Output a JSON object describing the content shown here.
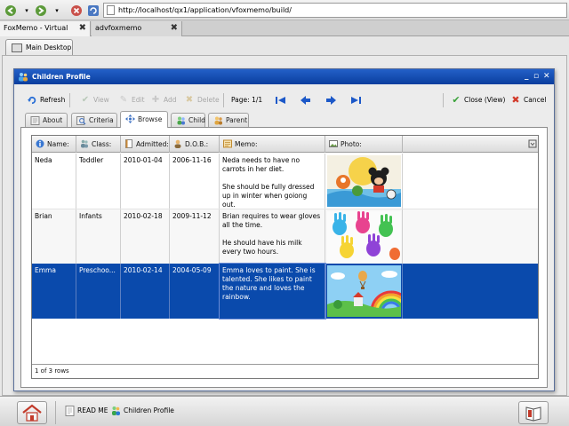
{
  "browser": {
    "url": "http://localhost/qx1/application/vfoxmemo/build/",
    "tabs": [
      {
        "label": "FoxMemo - Virtual"
      },
      {
        "label": "advfoxmemo"
      }
    ]
  },
  "desktop": {
    "tab_label": "Main Desktop"
  },
  "window": {
    "title": "Children Profile",
    "controls": {
      "minimize": "_",
      "restore": "▫",
      "close": "✕"
    }
  },
  "toolbar": {
    "refresh": "Refresh",
    "view": "View",
    "edit": "Edit",
    "add": "Add",
    "delete": "Delete",
    "page": "Page: 1/1",
    "close_view": "Close (View)",
    "cancel": "Cancel"
  },
  "page_tabs": [
    "About",
    "Criteria",
    "Browse",
    "Child",
    "Parent"
  ],
  "active_tab": "Browse",
  "grid": {
    "columns": [
      "Name:",
      "Class:",
      "Admitted:",
      "D.O.B.:",
      "Memo:",
      "Photo:"
    ],
    "rows": [
      {
        "name": "Neda",
        "class": "Toddler",
        "admitted": "2010-01-04",
        "dob": "2006-11-16",
        "memo1": "Neda needs to have no carrots in her diet.",
        "memo2": "She should be fully dressed up in winter when goiong out.",
        "photo": "cartoon-characters",
        "selected": false
      },
      {
        "name": "Brian",
        "class": "Infants",
        "admitted": "2010-02-18",
        "dob": "2009-11-12",
        "memo1": "Brian requires to wear gloves all the time.",
        "memo2": "He should have his milk every two hours.",
        "photo": "colorful-handprints",
        "selected": false
      },
      {
        "name": "Emma",
        "class": "Preschoo...",
        "admitted": "2010-02-14",
        "dob": "2004-05-09",
        "memo1": "Emma loves to paint. She is talented. She likes to paint the nature and loves the rainbow.",
        "memo2": "",
        "photo": "rainbow-landscape",
        "selected": true
      }
    ],
    "footer": "1 of 3 rows"
  },
  "taskbar": {
    "items": [
      "READ ME",
      "Children Profile"
    ]
  },
  "colors": {
    "title_bar": "#0a3e9e",
    "selection": "#0a4aac"
  }
}
